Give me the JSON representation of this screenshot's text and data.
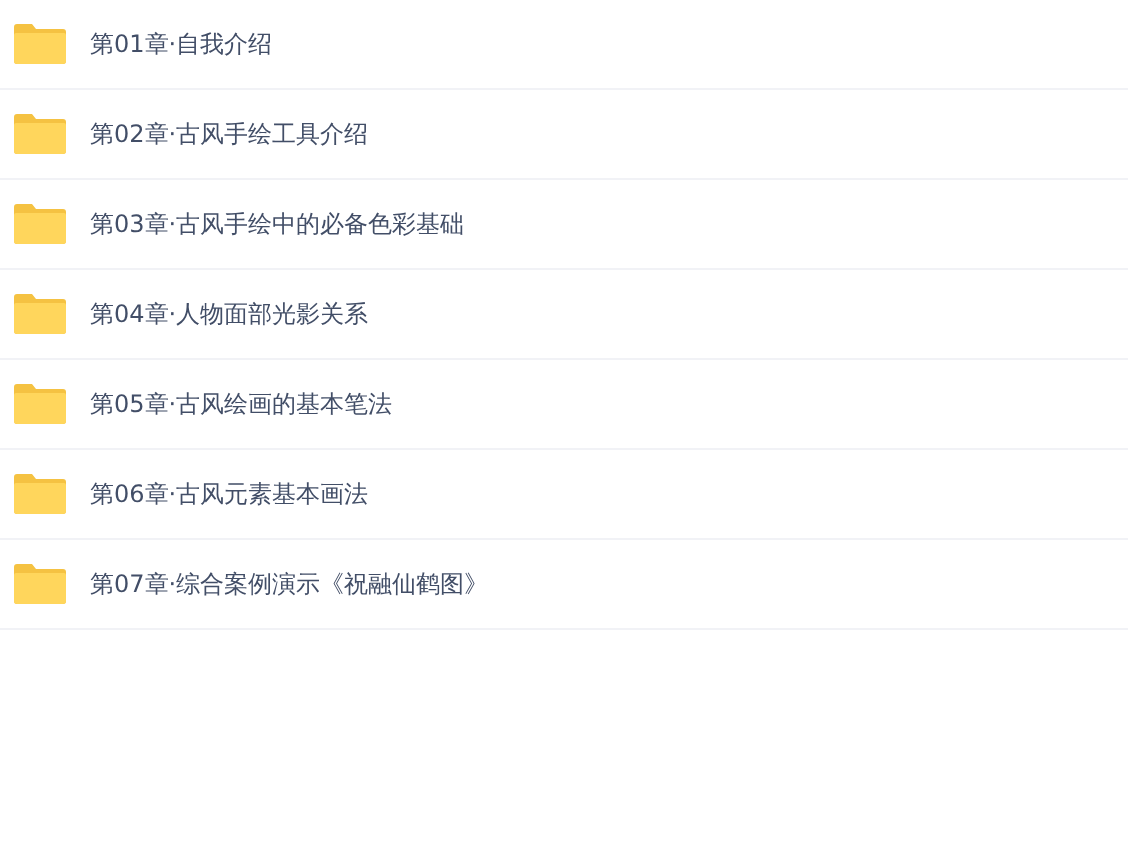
{
  "folders": [
    {
      "name": "第01章·自我介绍"
    },
    {
      "name": "第02章·古风手绘工具介绍"
    },
    {
      "name": "第03章·古风手绘中的必备色彩基础"
    },
    {
      "name": "第04章·人物面部光影关系"
    },
    {
      "name": "第05章·古风绘画的基本笔法"
    },
    {
      "name": "第06章·古风元素基本画法"
    },
    {
      "name": "第07章·综合案例演示《祝融仙鹤图》"
    }
  ]
}
